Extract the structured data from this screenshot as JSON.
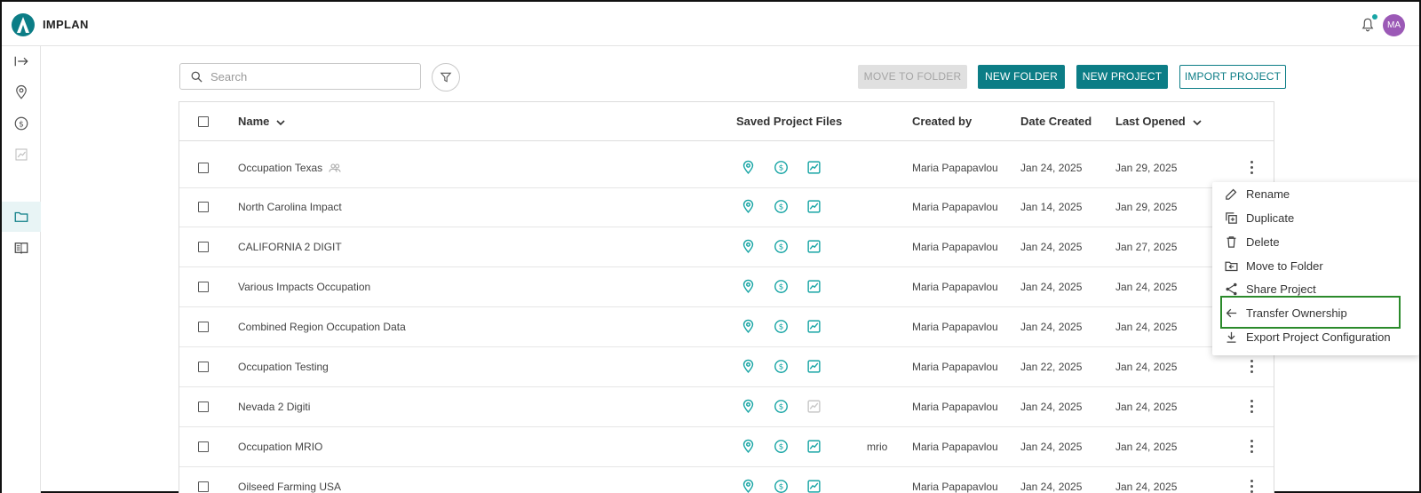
{
  "app": {
    "brand": "IMPLAN",
    "user_initials": "MA"
  },
  "toolbar": {
    "search_placeholder": "Search",
    "move_to_folder": "MOVE TO FOLDER",
    "new_folder": "NEW FOLDER",
    "new_project": "NEW PROJECT",
    "import_project": "IMPORT PROJECT"
  },
  "table": {
    "headers": {
      "name": "Name",
      "saved_files": "Saved Project Files",
      "created_by": "Created by",
      "date_created": "Date Created",
      "last_opened": "Last Opened"
    },
    "rows": [
      {
        "name": "Occupation Texas",
        "shared": true,
        "tag": "",
        "created_by": "Maria Papapavlou",
        "date_created": "Jan 24, 2025",
        "last_opened": "Jan 29, 2025",
        "chart_active": true
      },
      {
        "name": "North Carolina Impact",
        "shared": false,
        "tag": "",
        "created_by": "Maria Papapavlou",
        "date_created": "Jan 14, 2025",
        "last_opened": "Jan 29, 2025",
        "chart_active": true
      },
      {
        "name": "CALIFORNIA 2 DIGIT",
        "shared": false,
        "tag": "",
        "created_by": "Maria Papapavlou",
        "date_created": "Jan 24, 2025",
        "last_opened": "Jan 27, 2025",
        "chart_active": true
      },
      {
        "name": "Various Impacts Occupation",
        "shared": false,
        "tag": "",
        "created_by": "Maria Papapavlou",
        "date_created": "Jan 24, 2025",
        "last_opened": "Jan 24, 2025",
        "chart_active": true
      },
      {
        "name": "Combined Region Occupation Data",
        "shared": false,
        "tag": "",
        "created_by": "Maria Papapavlou",
        "date_created": "Jan 24, 2025",
        "last_opened": "Jan 24, 2025",
        "chart_active": true
      },
      {
        "name": "Occupation Testing",
        "shared": false,
        "tag": "",
        "created_by": "Maria Papapavlou",
        "date_created": "Jan 22, 2025",
        "last_opened": "Jan 24, 2025",
        "chart_active": true
      },
      {
        "name": "Nevada 2 Digiti",
        "shared": false,
        "tag": "",
        "created_by": "Maria Papapavlou",
        "date_created": "Jan 24, 2025",
        "last_opened": "Jan 24, 2025",
        "chart_active": false
      },
      {
        "name": "Occupation MRIO",
        "shared": false,
        "tag": "mrio",
        "created_by": "Maria Papapavlou",
        "date_created": "Jan 24, 2025",
        "last_opened": "Jan 24, 2025",
        "chart_active": true
      },
      {
        "name": "Oilseed Farming USA",
        "shared": false,
        "tag": "",
        "created_by": "Maria Papapavlou",
        "date_created": "Jan 24, 2025",
        "last_opened": "Jan 24, 2025",
        "chart_active": true
      }
    ]
  },
  "context_menu": {
    "items": [
      {
        "label": "Rename",
        "icon": "pencil-icon"
      },
      {
        "label": "Duplicate",
        "icon": "duplicate-icon"
      },
      {
        "label": "Delete",
        "icon": "trash-icon"
      },
      {
        "label": "Move to Folder",
        "icon": "folder-move-icon"
      },
      {
        "label": "Share Project",
        "icon": "share-icon"
      },
      {
        "label": "Transfer Ownership",
        "icon": "arrow-left-icon"
      },
      {
        "label": "Export Project Configuration",
        "icon": "download-icon"
      }
    ]
  },
  "colors": {
    "accent": "#0c7d86",
    "icon_teal": "#18a5a5",
    "avatar": "#9b59b6",
    "highlight": "#2b8a2b"
  }
}
